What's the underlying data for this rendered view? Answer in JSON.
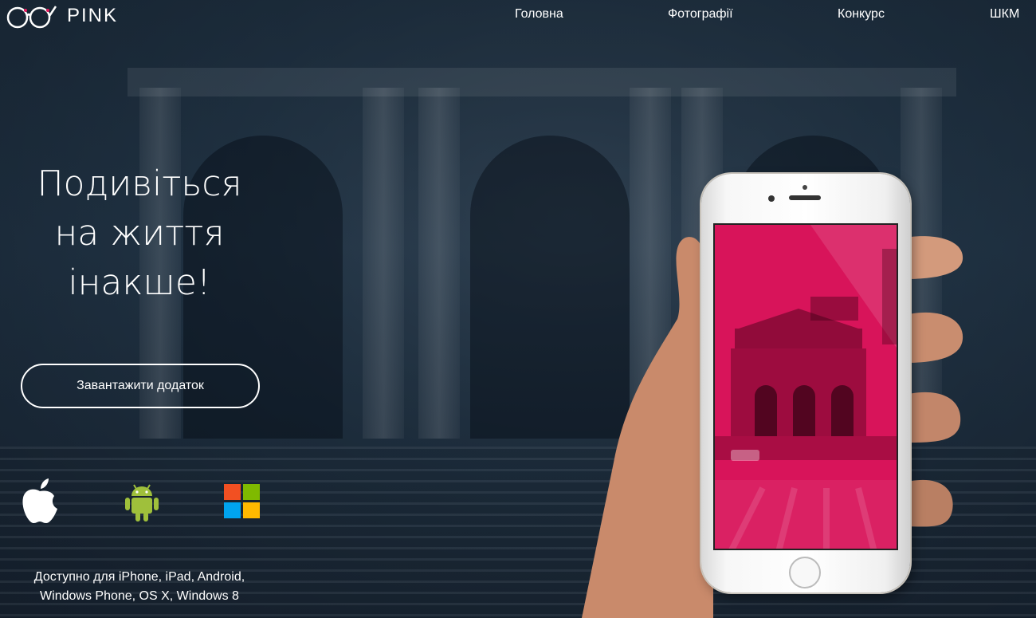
{
  "brand": {
    "name": "PINK",
    "accent": "#e5195e"
  },
  "nav": {
    "items": [
      {
        "label": "Головна"
      },
      {
        "label": "Фотографії"
      },
      {
        "label": "Конкурс"
      },
      {
        "label": "ШКМ"
      }
    ]
  },
  "hero": {
    "title_lines": [
      "Подивіться",
      "на життя",
      "інакше!"
    ],
    "download_button": "Завантажити додаток"
  },
  "platforms": [
    {
      "icon": "apple-icon"
    },
    {
      "icon": "android-icon"
    },
    {
      "icon": "windows-icon"
    }
  ],
  "availability": {
    "line1": "Доступно для iPhone, iPad, Android,",
    "line2": "Windows Phone, OS X, Windows 8"
  },
  "colors": {
    "screen": "#d8145a",
    "background": "#1c2a38"
  }
}
